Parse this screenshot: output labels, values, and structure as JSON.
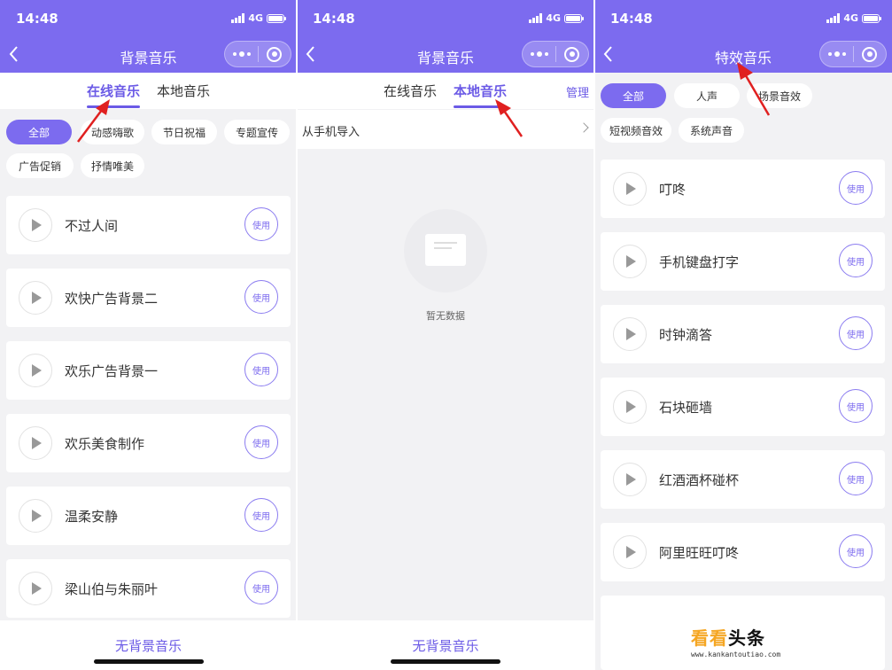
{
  "status": {
    "time": "14:48",
    "network": "4G"
  },
  "panels": {
    "online": {
      "title": "背景音乐",
      "tabs": [
        "在线音乐",
        "本地音乐"
      ],
      "active_tab": 0,
      "chips": [
        "全部",
        "动感嗨歌",
        "节日祝福",
        "专题宣传",
        "广告促销",
        "抒情唯美"
      ],
      "items": [
        "不过人间",
        "欢快广告背景二",
        "欢乐广告背景一",
        "欢乐美食制作",
        "温柔安静",
        "梁山伯与朱丽叶"
      ],
      "use_label": "使用",
      "footer": "无背景音乐"
    },
    "local": {
      "title": "背景音乐",
      "tabs": [
        "在线音乐",
        "本地音乐"
      ],
      "active_tab": 1,
      "manage": "管理",
      "import": "从手机导入",
      "empty": "暂无数据",
      "footer": "无背景音乐"
    },
    "effects": {
      "title": "特效音乐",
      "chips": [
        "全部",
        "人声",
        "场景音效",
        "短视频音效",
        "系统声音"
      ],
      "items": [
        "叮咚",
        "手机键盘打字",
        "时钟滴答",
        "石块砸墙",
        "红酒酒杯碰杯",
        "阿里旺旺叮咚"
      ],
      "use_label": "使用"
    }
  },
  "watermark": {
    "text_orange": "看看",
    "text_black": "头条",
    "url": "www.kankantoutiao.com"
  },
  "colors": {
    "brand": "#7c6bef",
    "annotation_arrow": "#e02020"
  }
}
